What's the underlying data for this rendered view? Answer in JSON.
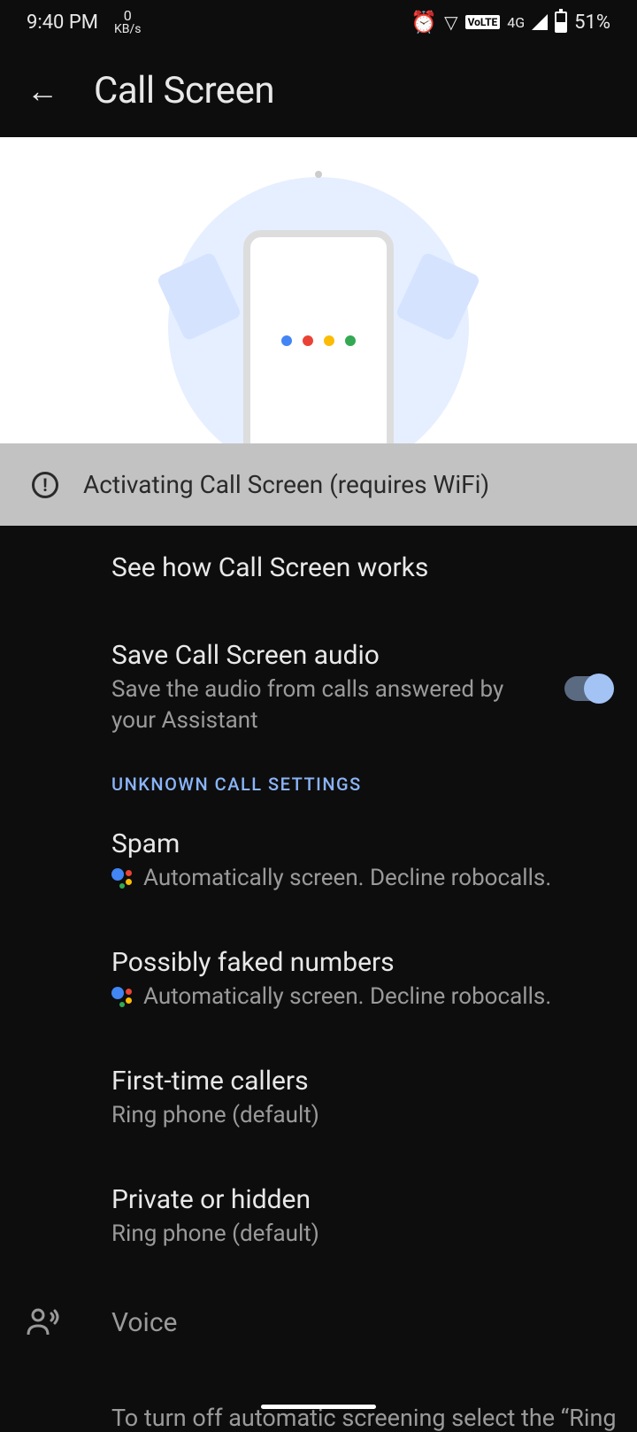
{
  "status_bar": {
    "time": "9:40 PM",
    "kbs_value": "0",
    "kbs_unit": "KB/s",
    "volte": "VoLTE",
    "network": "4G",
    "battery": "51%"
  },
  "header": {
    "title": "Call Screen"
  },
  "banner": {
    "message": "Activating Call Screen (requires WiFi)"
  },
  "items": {
    "how_works": {
      "title": "See how Call Screen works"
    },
    "save_audio": {
      "title": "Save Call Screen audio",
      "subtitle": "Save the audio from calls answered by your Assistant",
      "toggle_on": true
    }
  },
  "section": {
    "unknown_calls": "UNKNOWN CALL SETTINGS"
  },
  "unknown_settings": {
    "spam": {
      "title": "Spam",
      "subtitle": "Automatically screen. Decline robocalls."
    },
    "faked": {
      "title": "Possibly faked numbers",
      "subtitle": "Automatically screen. Decline robocalls."
    },
    "first_time": {
      "title": "First-time callers",
      "subtitle": "Ring phone (default)"
    },
    "private": {
      "title": "Private or hidden",
      "subtitle": "Ring phone (default)"
    }
  },
  "voice": {
    "label": "Voice"
  },
  "truncated_text": "To turn off automatic screening select the “Ring"
}
